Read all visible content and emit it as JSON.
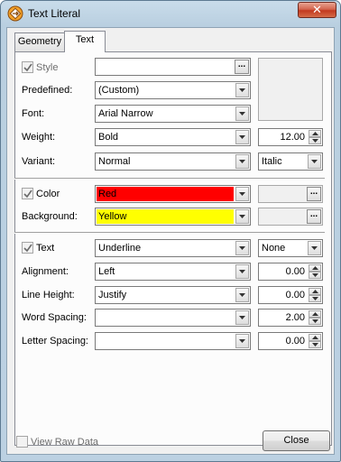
{
  "window": {
    "title": "Text Literal",
    "close_glyph": "✕"
  },
  "tabs": [
    {
      "label": "Geometry",
      "active": false
    },
    {
      "label": "Text",
      "active": true
    }
  ],
  "style_section": {
    "style_label": "Style",
    "style_checked": true,
    "style_value": "",
    "ellipsis": "...",
    "predefined_label": "Predefined:",
    "predefined_value": "(Custom)",
    "font_label": "Font:",
    "font_value": "Arial Narrow",
    "weight_label": "Weight:",
    "weight_value": "Bold",
    "size_value": "12.00",
    "variant_label": "Variant:",
    "variant_value": "Normal",
    "style_variant_value": "Italic"
  },
  "color_section": {
    "color_label": "Color",
    "color_checked": true,
    "color_value": "Red",
    "color_swatch": "#ff0000",
    "background_label": "Background:",
    "background_value": "Yellow",
    "background_swatch": "#ffff00",
    "ellipsis": "..."
  },
  "text_section": {
    "text_label": "Text",
    "text_checked": true,
    "decoration_value": "Underline",
    "transform_value": "None",
    "alignment_label": "Alignment:",
    "alignment_value": "Left",
    "alignment_num": "0.00",
    "line_height_label": "Line Height:",
    "line_height_value": "Justify",
    "line_height_num": "0.00",
    "word_spacing_label": "Word Spacing:",
    "word_spacing_value": "",
    "word_spacing_num": "2.00",
    "letter_spacing_label": "Letter Spacing:",
    "letter_spacing_value": "",
    "letter_spacing_num": "0.00"
  },
  "footer": {
    "view_raw_label": "View Raw Data",
    "view_raw_checked": false,
    "close_label": "Close"
  }
}
